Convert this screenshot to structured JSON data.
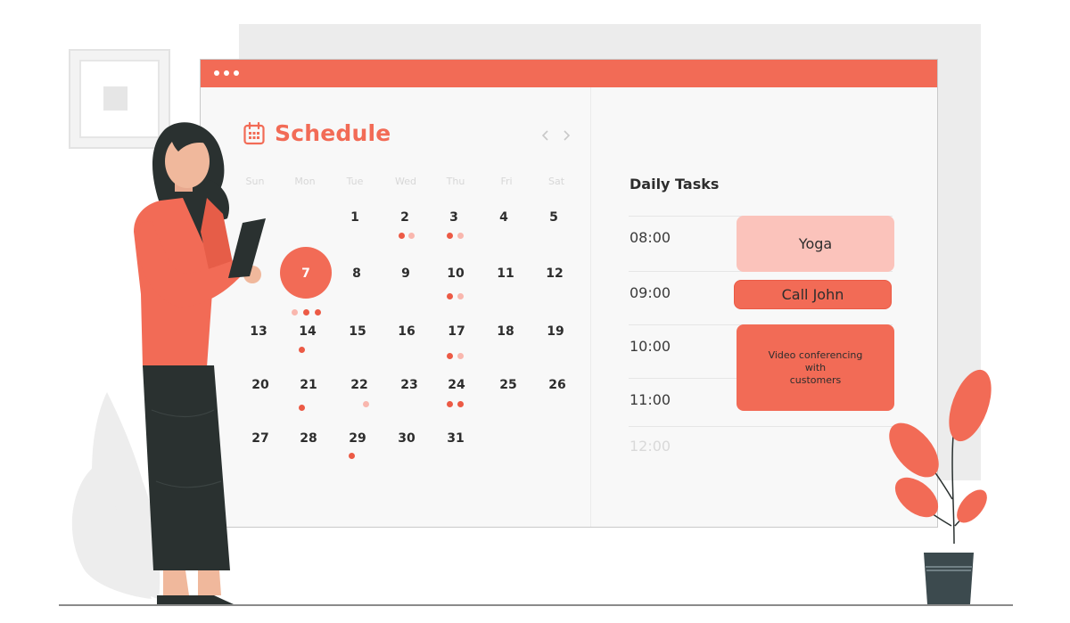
{
  "window": {
    "title_dots": 3,
    "accent_color": "#f26b56",
    "light_accent": "#fbc3bb"
  },
  "schedule": {
    "title": "Schedule",
    "icon": "calendar-icon",
    "prev_icon": "chevron-left-icon",
    "next_icon": "chevron-right-icon",
    "weekdays": [
      "Sun",
      "Mon",
      "Tue",
      "Wed",
      "Thu",
      "Fri",
      "Sat"
    ],
    "weeks": [
      [
        "",
        "",
        "1",
        "2",
        "3",
        "4",
        "5"
      ],
      [
        "",
        "7",
        "8",
        "9",
        "10",
        "11",
        "12"
      ],
      [
        "13",
        "14",
        "15",
        "16",
        "17",
        "18",
        "19"
      ],
      [
        "20",
        "21",
        "22",
        "23",
        "24",
        "25",
        "26"
      ],
      [
        "27",
        "28",
        "29",
        "30",
        "31",
        "",
        ""
      ]
    ],
    "selected_day": "7"
  },
  "tasks": {
    "title": "Daily Tasks",
    "times": [
      "08:00",
      "09:00",
      "10:00",
      "11:00",
      "12:00"
    ],
    "items": [
      {
        "label": "Yoga"
      },
      {
        "label": "Call John"
      },
      {
        "label": "Video conferencing\nwith\ncustomers"
      }
    ]
  }
}
